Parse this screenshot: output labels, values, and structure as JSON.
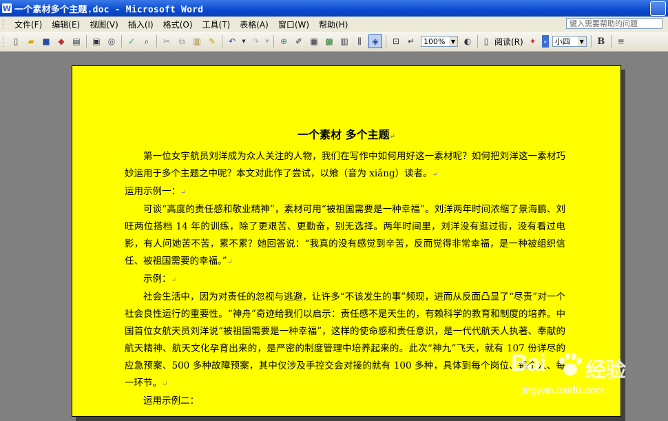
{
  "window": {
    "title": "一个素材多个主题.doc - Microsoft Word",
    "app_icon": "W"
  },
  "menubar": {
    "items": [
      "文件(F)",
      "编辑(E)",
      "视图(V)",
      "插入(I)",
      "格式(O)",
      "工具(T)",
      "表格(A)",
      "窗口(W)",
      "帮助(H)"
    ],
    "help_placeholder": "键入需要帮助的问题"
  },
  "toolbar": {
    "zoom": "100%",
    "read_label": "阅读(R)",
    "font_size": "小四",
    "bold_label": "B"
  },
  "document": {
    "title": "一个素材  多个主题",
    "paragraphs": [
      {
        "text": "第一位女宇航员刘洋成为众人关注的人物，我们在写作中如何用好这一素材呢？如何把刘洋这一素材巧妙运用于多个主题之中呢？本文对此作了尝试，以飨（音为 xiǎng）读者。",
        "indent": true
      },
      {
        "text": "运用示例一：",
        "indent": false
      },
      {
        "text": "可谈“高度的责任感和敬业精神”，素材可用“被祖国需要是一种幸福”。刘洋两年时间浓缩了景海鹏、刘旺两位搭档 14 年的训练，除了更艰苦、更勤奋，别无选择。两年时间里，刘洋没有逛过街，没有看过电影，有人问她苦不苦，累不累？她回答说：“我真的没有感觉到辛苦，反而觉得非常幸福，是一种被组织信任、被祖国需要的幸福。”",
        "indent": true
      },
      {
        "text": "示例：",
        "indent": true
      },
      {
        "text": "社会生活中，因为对责任的忽视与逃避，让许多“不该发生的事”频现，进而从反面凸显了“尽责”对一个社会良性运行的重要性。“神舟”奇迹给我们以启示：责任感不是天生的，有赖科学的教育和制度的培养。中国首位女航天员刘洋说“被祖国需要是一种幸福”，这样的使命感和责任意识，是一代代航天人执著、奉献的航天精神、航天文化孕育出来的，是严密的制度管理中培养起来的。此次“神九”飞天，就有 107 份详尽的应急预案、500 多种故障预案，其中仅涉及手控交会对接的就有 100 多种，具体到每个岗位、每个人、每一环节。",
        "indent": true
      },
      {
        "text": "运用示例二：",
        "indent": true
      }
    ]
  },
  "watermark": {
    "logo": "Bai",
    "brand": "经验",
    "url": "jingyan.baidu.com"
  }
}
